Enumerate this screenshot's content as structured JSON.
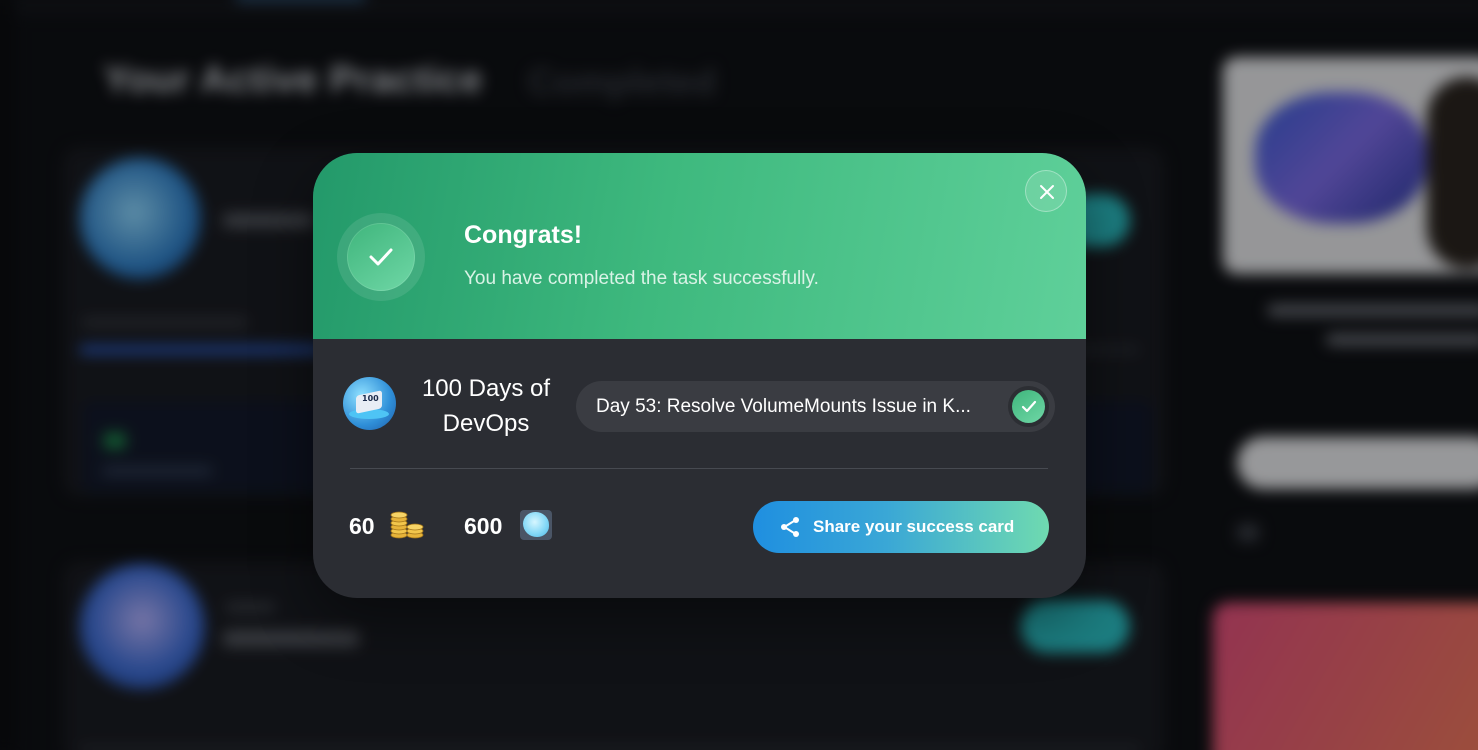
{
  "background": {
    "heading": "Your Active Practice",
    "tab_completed": "Completed"
  },
  "modal": {
    "title": "Congrats!",
    "subtitle": "You have completed the task successfully.",
    "course": {
      "title": "100 Days of DevOps",
      "icon_number": "100"
    },
    "task": {
      "label": "Day 53: Resolve VolumeMounts Issue in K...",
      "status": "completed"
    },
    "rewards": {
      "coins": "60",
      "gems": "600"
    },
    "share_button_label": "Share your success card",
    "colors": {
      "header_start": "#23996a",
      "header_end": "#5fd09a",
      "share_start": "#1f8fe0",
      "share_end": "#6fdab0",
      "modal_bg": "#2b2d33"
    },
    "icons": {
      "success": "check-icon",
      "close": "close-icon",
      "coins": "coins-icon",
      "gems": "gem-icon",
      "share": "share-icon"
    }
  }
}
